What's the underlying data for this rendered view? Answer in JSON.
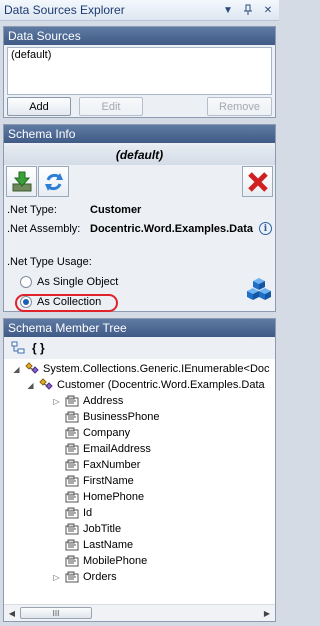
{
  "window": {
    "title": "Data Sources Explorer"
  },
  "data_sources": {
    "header": "Data Sources",
    "items": [
      "(default)"
    ],
    "buttons": {
      "add": "Add",
      "edit": "Edit",
      "remove": "Remove"
    }
  },
  "schema_info": {
    "header": "Schema Info",
    "name": "(default)",
    "net_type_label": ".Net Type:",
    "net_type_value": "Customer",
    "net_assembly_label": ".Net Assembly:",
    "net_assembly_value": "Docentric.Word.Examples.Data",
    "usage_label": ".Net Type Usage:",
    "usage_options": [
      "As Single Object",
      "As Collection"
    ],
    "usage_selected": "As Collection"
  },
  "member_tree": {
    "header": "Schema Member Tree",
    "toolbar_braces": "{ }",
    "root": "System.Collections.Generic.IEnumerable<Doc",
    "child": "Customer (Docentric.Word.Examples.Data",
    "members": [
      "Address",
      "BusinessPhone",
      "Company",
      "EmailAddress",
      "FaxNumber",
      "FirstName",
      "HomePhone",
      "Id",
      "JobTitle",
      "LastName",
      "MobilePhone",
      "Orders"
    ],
    "expandable_members": [
      "Address",
      "Orders"
    ],
    "scroll_grip": "III"
  }
}
